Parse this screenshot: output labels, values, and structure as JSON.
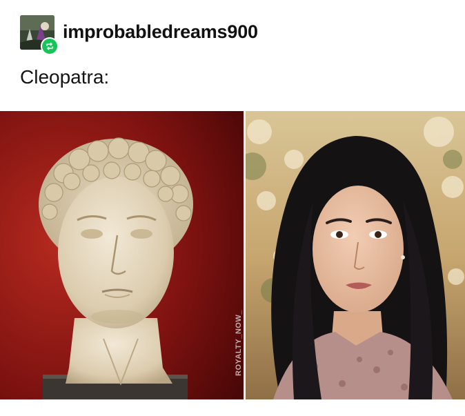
{
  "post": {
    "username": "improbabledreams900",
    "caption": "Cleopatra:",
    "watermark": "ROYALTY_NOW_"
  },
  "icons": {
    "avatar": "user-avatar",
    "badge": "reblog-icon"
  },
  "colors": {
    "reblog_badge": "#16c45a",
    "left_background": "#8a1512",
    "right_background": "#c8b58a"
  }
}
